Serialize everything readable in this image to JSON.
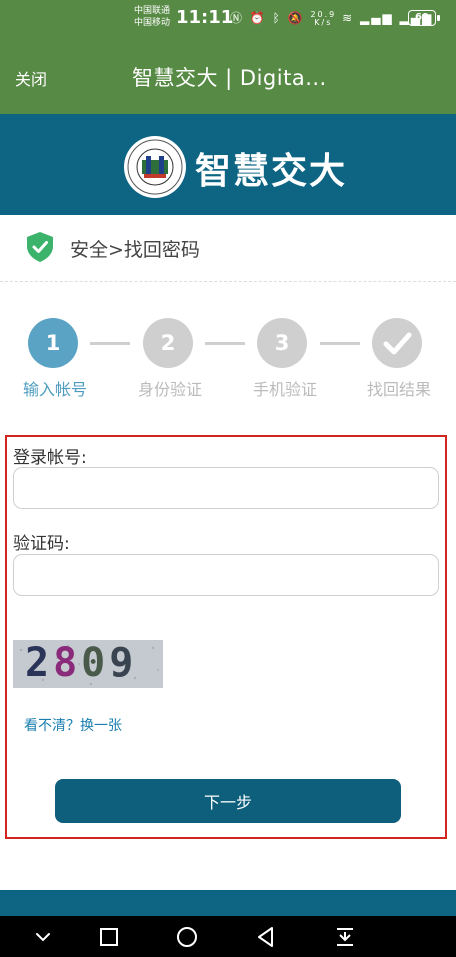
{
  "status_bar": {
    "carrier_1": "中国联通",
    "carrier_2": "中国移动",
    "time": "11:11",
    "net_speed_value": "20.9",
    "net_speed_unit": "K/s",
    "battery": "69"
  },
  "app_bar": {
    "close_label": "关闭",
    "title": "智慧交大 | Digita..."
  },
  "header": {
    "brand": "智慧交大"
  },
  "breadcrumb": {
    "text": "安全>找回密码"
  },
  "steps": [
    {
      "number": "1",
      "label": "输入帐号",
      "state": "active"
    },
    {
      "number": "2",
      "label": "身份验证",
      "state": "pending"
    },
    {
      "number": "3",
      "label": "手机验证",
      "state": "pending"
    },
    {
      "number": "✓",
      "label": "找回结果",
      "state": "pending"
    }
  ],
  "form": {
    "account_label": "登录帐号:",
    "account_value": "",
    "code_label": "验证码:",
    "code_value": "",
    "captcha_text": "2809",
    "refresh_link": "看不清？换一张",
    "next_button": "下一步"
  },
  "colors": {
    "app_bar_green": "#578a45",
    "brand_blue": "#0e6583",
    "active_step": "#5ba3c4",
    "highlight_border": "#d0261f"
  }
}
